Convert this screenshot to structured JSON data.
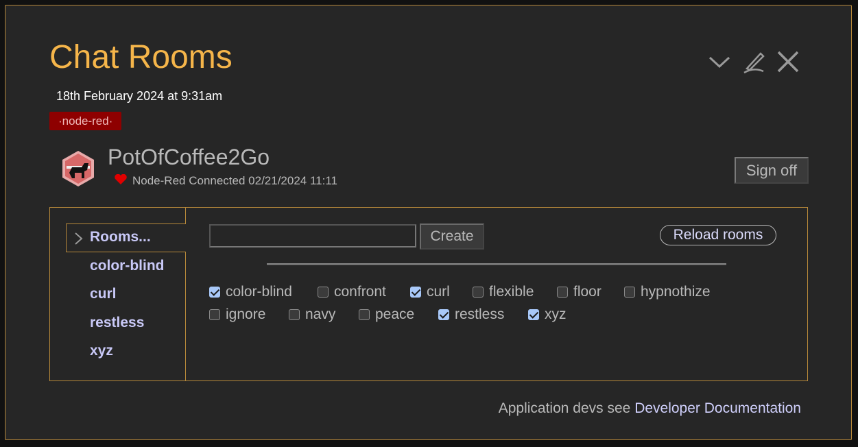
{
  "header": {
    "title": "Chat Rooms",
    "date": "18th February 2024 at 9:31am",
    "tag": "·node-red·"
  },
  "user": {
    "name": "PotOfCoffee2Go",
    "status": "Node-Red Connected 02/21/2024 11:11",
    "signoff": "Sign off"
  },
  "toolbar": {
    "icons": [
      "chevron-down-icon",
      "edit-pencil-icon",
      "close-icon"
    ]
  },
  "sidebar": {
    "items": [
      {
        "label": "Rooms..."
      },
      {
        "label": "color-blind"
      },
      {
        "label": "curl"
      },
      {
        "label": "restless"
      },
      {
        "label": "xyz"
      }
    ]
  },
  "main": {
    "input_value": "",
    "create_label": "Create",
    "reload_label": "Reload rooms",
    "rooms": [
      {
        "label": "color-blind",
        "checked": true
      },
      {
        "label": "confront",
        "checked": false
      },
      {
        "label": "curl",
        "checked": true
      },
      {
        "label": "flexible",
        "checked": false
      },
      {
        "label": "floor",
        "checked": false
      },
      {
        "label": "hypnothize",
        "checked": false
      },
      {
        "label": "ignore",
        "checked": false
      },
      {
        "label": "navy",
        "checked": false
      },
      {
        "label": "peace",
        "checked": false
      },
      {
        "label": "restless",
        "checked": true
      },
      {
        "label": "xyz",
        "checked": true
      }
    ]
  },
  "footer": {
    "text": "Application devs see ",
    "link": "Developer Documentation"
  },
  "colors": {
    "accent": "#f5b54a",
    "tag_bg": "#8e0000",
    "link": "#cfcffb",
    "checked": "#a8c8f8"
  }
}
